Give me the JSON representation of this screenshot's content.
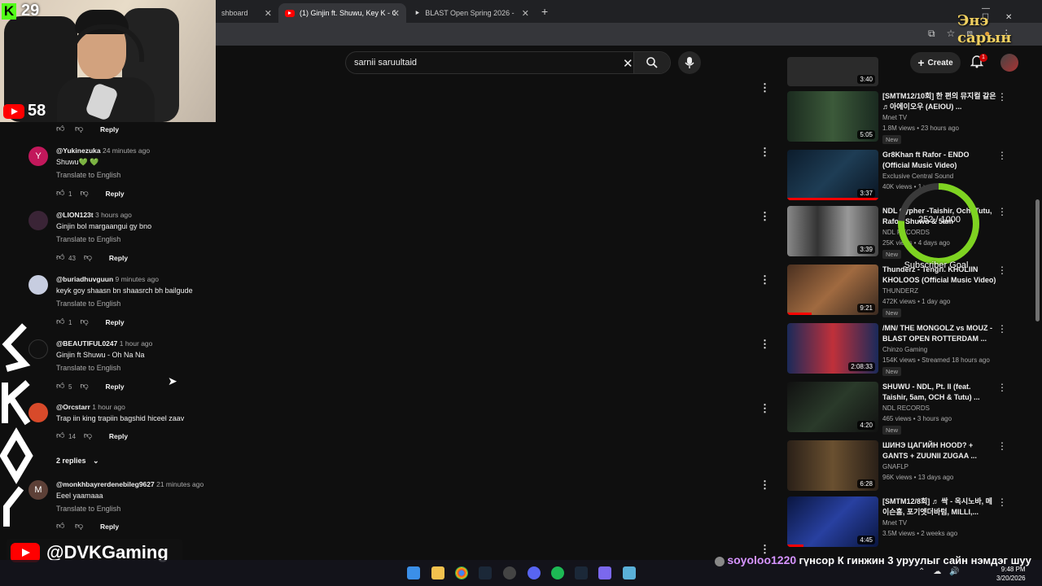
{
  "browser": {
    "tabs": [
      {
        "label": "shboard",
        "active": false
      },
      {
        "label": "(1) Ginjin ft. Shuwu, Key K - Oh",
        "active": true
      },
      {
        "label": "BLAST Open Spring 2026 - Liqu",
        "active": false
      }
    ],
    "new_tab": "+"
  },
  "header": {
    "search_query": "sarnii saruultaid",
    "create_label": "Create",
    "notification_count": "1"
  },
  "overlay": {
    "kick_count": "29",
    "youtube_count": "58",
    "handle": "@DVKGaming",
    "top_right_text": "Энэ сарын",
    "goal_progress": "252 / 1000",
    "goal_label": "Subscriber Goal",
    "chat_user": "soyoloo1220",
    "chat_message": "гүнсор К гинжин 3 уруулыг сайн нэмдэг шуу"
  },
  "comments": [
    {
      "likes": "",
      "reply": "Reply",
      "partial": true
    },
    {
      "author": "@Yukinezuka",
      "time": "24 minutes ago",
      "text": "Shuwu💚 💚",
      "translate": "Translate to English",
      "likes": "1",
      "reply": "Reply"
    },
    {
      "author": "@LION123t",
      "time": "3 hours ago",
      "text": "Ginjin bol margaangui gy bno",
      "translate": "Translate to English",
      "likes": "43",
      "reply": "Reply"
    },
    {
      "author": "@buriadhuvguun",
      "time": "9 minutes ago",
      "text": "keyk goy shaasn bn shaasrch bh bailgude",
      "translate": "Translate to English",
      "likes": "1",
      "reply": "Reply"
    },
    {
      "author": "@BEAUTIFUL0247",
      "time": "1 hour ago",
      "text": "Ginjin ft Shuwu - Oh Na Na",
      "translate": "Translate to English",
      "likes": "5",
      "reply": "Reply"
    },
    {
      "author": "@Orcstarr",
      "time": "1 hour ago",
      "text": "Trap iin king trapiin bagshid hiceel zaav",
      "translate": "",
      "likes": "14",
      "reply": "Reply"
    },
    {
      "author": "@monkhbayrerdenebileg9627",
      "time": "21 minutes ago",
      "text": "Eeel yaamaaa",
      "translate": "Translate to English",
      "likes": "",
      "reply": "Reply"
    }
  ],
  "replies_toggle": "2 replies",
  "sidebar": [
    {
      "title": "",
      "channel": "",
      "meta": "",
      "duration": "3:40",
      "badge": ""
    },
    {
      "title": "[SMTM12/10회] 한 편의 뮤지컬 같은 ♬아에이오우 (AEIOU) ...",
      "channel": "Mnet TV",
      "meta": "1.8M views • 23 hours ago",
      "duration": "5:05",
      "badge": "New"
    },
    {
      "title": "Gr8Khan ft Rafor - ENDO (Official Music Video)",
      "channel": "Exclusive Central Sound",
      "meta": "40K views • 1 year ago",
      "duration": "3:37",
      "badge": ""
    },
    {
      "title": "NDL Cypher -Taishir, Och, Tutu, Rafor, Shuwu & 5am",
      "channel": "NDL RECORDS",
      "meta": "25K views • 4 days ago",
      "duration": "3:39",
      "badge": "New"
    },
    {
      "title": "Thunderz - Tengri. KHOLIIN KHOLOOS (Official Music Video)",
      "channel": "THUNDERZ",
      "meta": "472K views • 1 day ago",
      "duration": "9:21",
      "badge": "New"
    },
    {
      "title": "/MN/ THE MONGOLZ vs MOUZ - BLAST OPEN ROTTERDAM ...",
      "channel": "Chinzo Gaming",
      "meta": "154K views • Streamed 18 hours ago",
      "duration": "2:08:33",
      "badge": "New"
    },
    {
      "title": "SHUWU - NDL, Pt. II (feat. Taishir, 5am, OCH & Tutu) ...",
      "channel": "NDL RECORDS",
      "meta": "465 views • 3 hours ago",
      "duration": "4:20",
      "badge": "New"
    },
    {
      "title": "ШИНЭ ЦАГИЙН HOOD? + GANTS + ZUUNII ZUGAA ...",
      "channel": "GNAFLP",
      "meta": "96K views • 13 days ago",
      "duration": "6:28",
      "badge": ""
    },
    {
      "title": "[SMTM12/8회] ♬ 싹 - 옥시노바, 메이슨홈, 포기엣더바텀, MILLI,...",
      "channel": "Mnet TV",
      "meta": "3.5M views • 2 weeks ago",
      "duration": "4:45",
      "badge": ""
    }
  ],
  "taskbar": {
    "time": "9:48 PM",
    "date": "3/20/2026"
  },
  "colors": {
    "bg": "#0f0f0f",
    "accent": "#ff0000",
    "kick": "#53fc18",
    "goal": "#7ed321"
  }
}
